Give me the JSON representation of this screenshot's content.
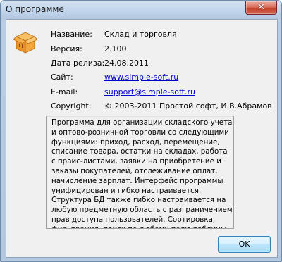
{
  "window": {
    "title": "О программе",
    "close_glyph": "✕"
  },
  "icon": {
    "name": "package-box-icon",
    "color": "#f0a030"
  },
  "info": [
    {
      "label": "Название:",
      "value": "Склад и торговля"
    },
    {
      "label": "Версия:",
      "value": "2.100"
    },
    {
      "label": "Дата релиза:",
      "value": "24.08.2011"
    },
    {
      "label": "Сайт:",
      "value": "www.simple-soft.ru"
    },
    {
      "label": "E-mail:",
      "value": "support@simple-soft.ru"
    },
    {
      "label": "Copyright:",
      "value": "© 2003-2011 Простой софт, И.В.Абрамов"
    }
  ],
  "description": "Программа для организации складского учета и оптово-розничной торговли со следующими функциями: приход, расход, перемещение, списание товара, остатки на складах, работа с прайс-листами, заявки на приобретение и заказы покупателей, отслеживание оплат, начисление зарплат. Интерфейс программы унифицирован и гибко настраивается. Структура БД также гибко настраивается на любую предметную область с разграничением прав доступа пользователей. Сортировка, фильтрация, поиск по любому полю таблицы, правила цветовыделения, емейл рассылки, напоминания, экспорт и импорт данных и др.",
  "buttons": {
    "ok": "OK"
  }
}
